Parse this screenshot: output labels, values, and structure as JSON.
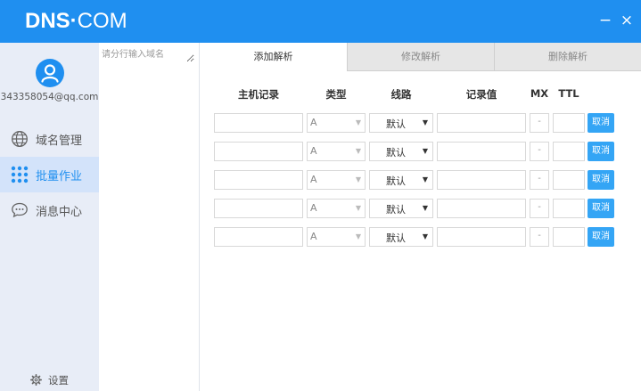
{
  "app": {
    "logo_bold": "DNS",
    "logo_dot": "·",
    "logo_light": "COM",
    "minimize": "−",
    "close": "×"
  },
  "user": {
    "email": "343358054@qq.com"
  },
  "nav": {
    "domain": "域名管理",
    "batch": "批量作业",
    "messages": "消息中心",
    "active": "batch"
  },
  "settings": {
    "label": "设置"
  },
  "domain_list": {
    "placeholder": "请分行输入域名"
  },
  "tabs": [
    {
      "label": "添加解析",
      "active": true
    },
    {
      "label": "修改解析",
      "active": false
    },
    {
      "label": "删除解析",
      "active": false
    }
  ],
  "form": {
    "headers": {
      "host": "主机记录",
      "type": "类型",
      "line": "线路",
      "value": "记录值",
      "mx": "MX",
      "ttl": "TTL"
    },
    "rows": [
      {
        "host": "",
        "type": "A",
        "line": "默认",
        "value": "",
        "mx": "-",
        "ttl": "",
        "cancel": "取消"
      },
      {
        "host": "",
        "type": "A",
        "line": "默认",
        "value": "",
        "mx": "-",
        "ttl": "",
        "cancel": "取消"
      },
      {
        "host": "",
        "type": "A",
        "line": "默认",
        "value": "",
        "mx": "-",
        "ttl": "",
        "cancel": "取消"
      },
      {
        "host": "",
        "type": "A",
        "line": "默认",
        "value": "",
        "mx": "-",
        "ttl": "",
        "cancel": "取消"
      },
      {
        "host": "",
        "type": "A",
        "line": "默认",
        "value": "",
        "mx": "-",
        "ttl": "",
        "cancel": "取消"
      }
    ]
  },
  "colors": {
    "brand": "#1f8ff0",
    "sidebar_bg": "#e8edf7",
    "nav_active_bg": "#d3e3fa",
    "cancel_button": "#34a5f5"
  },
  "icons": {
    "avatar": "user-avatar-icon",
    "domain": "globe-icon",
    "batch": "dots-grid-icon",
    "messages": "chat-bubble-icon",
    "settings": "gear-icon"
  }
}
